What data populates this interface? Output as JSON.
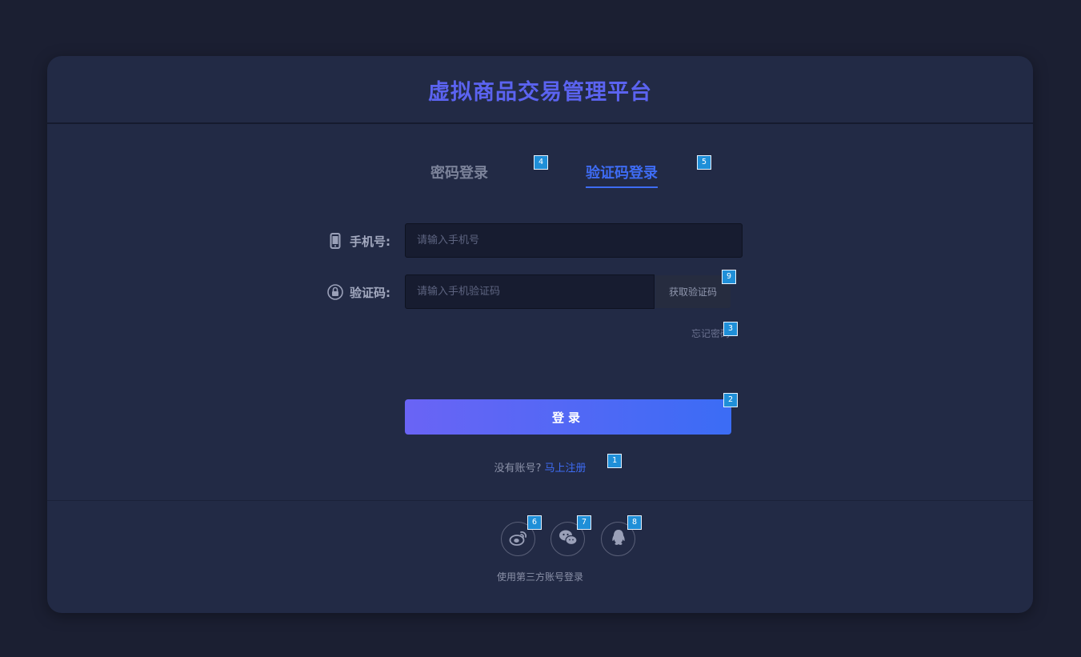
{
  "app": {
    "title": "虚拟商品交易管理平台"
  },
  "tabs": [
    {
      "label": "密码登录",
      "active": false
    },
    {
      "label": "验证码登录",
      "active": true
    }
  ],
  "form": {
    "phone_label": "手机号:",
    "phone_placeholder": "请输入手机号",
    "phone_value": "",
    "code_label": "验证码:",
    "code_placeholder": "请输入手机验证码",
    "code_value": "",
    "get_code_label": "获取验证码",
    "forgot_label": "忘记密码"
  },
  "login_button": "登录",
  "register": {
    "prompt": "没有账号?",
    "link": "马上注册"
  },
  "social": {
    "caption": "使用第三方账号登录",
    "providers": [
      {
        "name": "weibo",
        "icon": "weibo-icon"
      },
      {
        "name": "wechat",
        "icon": "wechat-icon"
      },
      {
        "name": "qq",
        "icon": "qq-icon"
      }
    ]
  },
  "badges": [
    "1",
    "2",
    "3",
    "4",
    "5",
    "6",
    "7",
    "8",
    "9"
  ],
  "colors": {
    "background": "#1b1f32",
    "card": "#222a45",
    "accent": "#3e6cf4",
    "title": "#5b63f0",
    "badge": "#1f8fd8"
  }
}
